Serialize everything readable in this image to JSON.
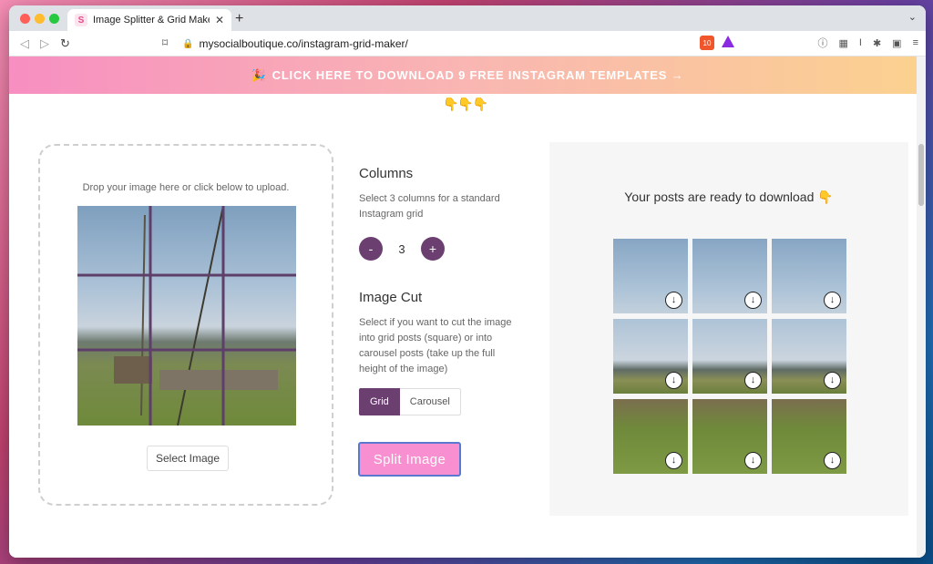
{
  "browser": {
    "tab_title": "Image Splitter & Grid Maker for",
    "tab_favicon": "S",
    "url": "mysocialboutique.co/instagram-grid-maker/",
    "brave_badge": "10"
  },
  "banner": {
    "icon": "party-popper-icon",
    "text": "CLICK HERE TO DOWNLOAD 9 FREE INSTAGRAM TEMPLATES →",
    "pointers": "👇👇👇"
  },
  "upload": {
    "hint": "Drop your image here or click below to upload.",
    "select_label": "Select Image"
  },
  "columns": {
    "title": "Columns",
    "description": "Select 3 columns for a standard Instagram grid",
    "minus_label": "-",
    "value": "3",
    "plus_label": "+"
  },
  "image_cut": {
    "title": "Image Cut",
    "description": "Select if you want to cut the image into grid posts (square) or into carousel posts (take up the full height of the image)",
    "options": [
      "Grid",
      "Carousel"
    ],
    "selected": "Grid"
  },
  "split": {
    "label": "Split Image"
  },
  "results": {
    "title": "Your posts are ready to download 👇",
    "tiles": 9
  },
  "colors": {
    "accent_purple": "#6b3f70",
    "split_button": "#f78fd0",
    "banner_start": "#f78fc1",
    "banner_end": "#fbd28f"
  }
}
